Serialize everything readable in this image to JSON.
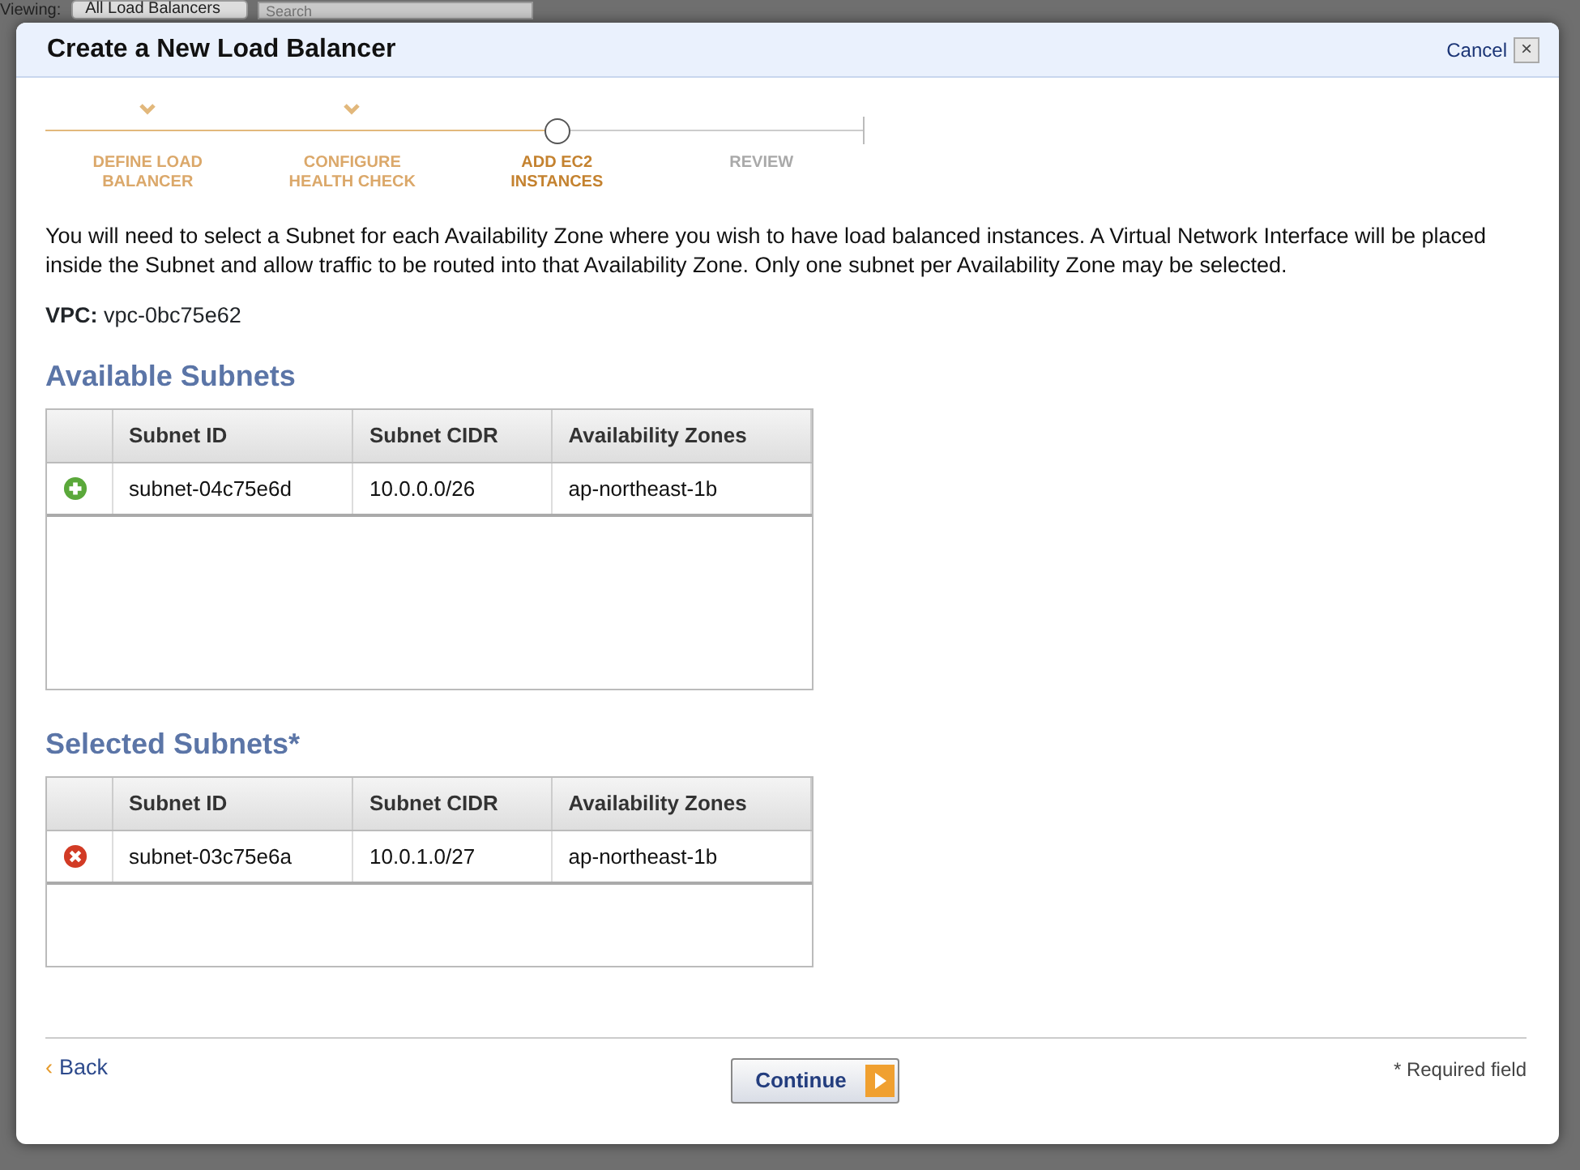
{
  "background_toolbar": {
    "label": "Viewing:",
    "filter": "All Load Balancers",
    "search": {
      "placeholder": "Search"
    }
  },
  "dialog": {
    "title": "Create a New Load Balancer",
    "cancel": "Cancel",
    "close": "×"
  },
  "steps": [
    {
      "label": "DEFINE LOAD BALANCER",
      "kind": "done"
    },
    {
      "label": "CONFIGURE HEALTH CHECK",
      "kind": "done"
    },
    {
      "label": "ADD EC2 INSTANCES",
      "kind": "current"
    },
    {
      "label": "REVIEW",
      "kind": "pending"
    }
  ],
  "intro": "You will need to select a Subnet for each Availability Zone where you wish to have load balanced instances. A Virtual Network Interface will be placed inside the Subnet and allow traffic to be routed into that Availability Zone. Only one subnet per Availability Zone may be selected.",
  "vpc": {
    "label": "VPC:",
    "value": "vpc-0bc75e62"
  },
  "tables": [
    {
      "title": "Available Subnets",
      "kind": "add",
      "columns": [
        "Subnet ID",
        "Subnet CIDR",
        "Availability Zones"
      ],
      "rows": [
        [
          "subnet-04c75e6d",
          "10.0.0.0/26",
          "ap-northeast-1b"
        ]
      ]
    },
    {
      "title": "Selected Subnets*",
      "kind": "remove",
      "columns": [
        "Subnet ID",
        "Subnet CIDR",
        "Availability Zones"
      ],
      "rows": [
        [
          "subnet-03c75e6a",
          "10.0.1.0/27",
          "ap-northeast-1b"
        ]
      ]
    }
  ],
  "footer": {
    "back": "Back",
    "back_arrow": "‹",
    "continue": "Continue",
    "required_note": "* Required field"
  }
}
